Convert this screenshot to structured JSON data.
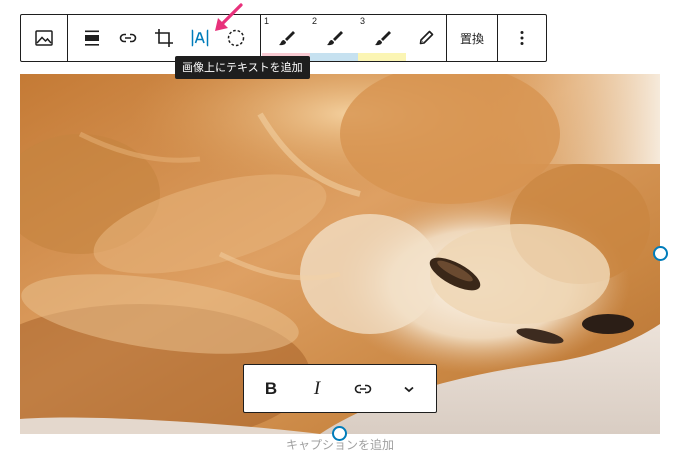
{
  "toolbar": {
    "tools": [
      {
        "name": "change-block-type",
        "icon": "image-icon"
      },
      {
        "name": "align",
        "icon": "align-wide-icon"
      },
      {
        "name": "link",
        "icon": "link-icon"
      },
      {
        "name": "crop",
        "icon": "crop-icon"
      },
      {
        "name": "add-text-over-image",
        "icon": "text-over-image-icon",
        "active": true
      },
      {
        "name": "duotone",
        "icon": "dashed-circle-icon"
      }
    ],
    "styles": [
      {
        "number": "1",
        "icon": "brush-icon",
        "color": "#f9cbd3"
      },
      {
        "number": "2",
        "icon": "brush-icon",
        "color": "#c6e1f0"
      },
      {
        "number": "3",
        "icon": "brush-icon",
        "color": "#fbf5b4"
      }
    ],
    "pen_icon": "pencil-icon",
    "replace_label": "置換",
    "more_icon": "more-vertical-icon"
  },
  "tooltip": {
    "text": "画像上にテキストを追加"
  },
  "annotation": {
    "arrow_color": "#e8317b"
  },
  "format_toolbar": {
    "bold_label": "B",
    "italic_label": "I",
    "link_icon": "link-icon",
    "more_icon": "chevron-down-icon"
  },
  "image": {
    "subject": "sleeping-dog-photo",
    "handle_color": "#007cba"
  },
  "caption": {
    "placeholder": "キャプションを追加"
  }
}
